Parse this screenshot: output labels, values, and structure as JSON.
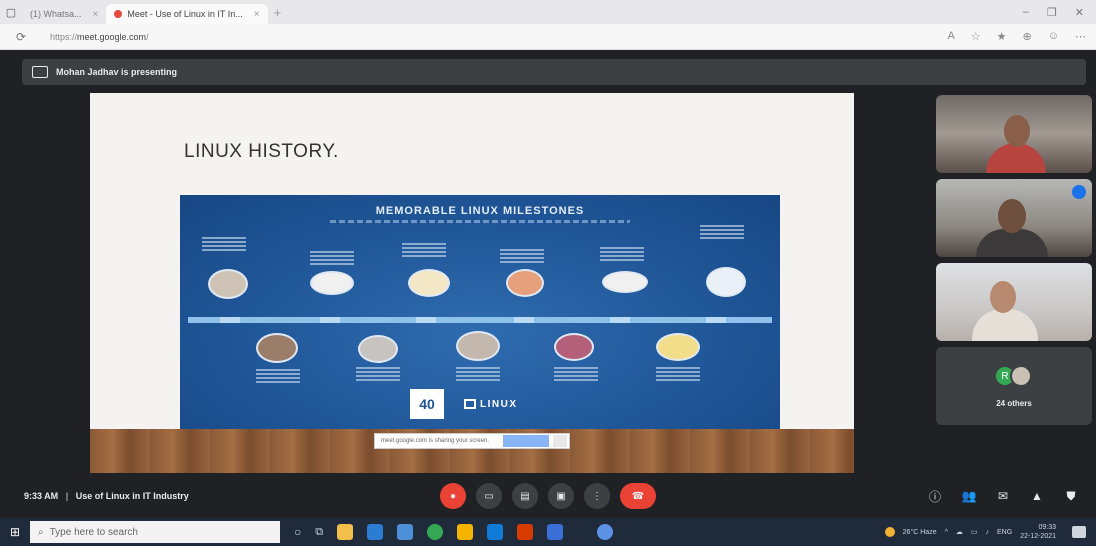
{
  "browser": {
    "tabs": [
      {
        "label": "(1) Whatsa..."
      },
      {
        "label": "Meet - Use of Linux in IT In..."
      }
    ],
    "url_prefix": "https://",
    "url_domain": "meet.google.com",
    "url_path": "/"
  },
  "meet": {
    "presenter_text": "Mohan Jadhav is presenting",
    "slide": {
      "title": "LINUX HISTORY.",
      "poster_title": "MEMORABLE LINUX MILESTONES",
      "logo_40": "40",
      "logo_linux": "LINUX",
      "stop_sharing_text": "meet.google.com is sharing your screen."
    },
    "others_avatar_letter": "R",
    "others_label": "24 others",
    "meeting_time": "9:33 AM",
    "meeting_name": "Use of Linux in IT Industry"
  },
  "taskbar": {
    "search_placeholder": "Type here to search",
    "weather": "26°C Haze",
    "lang": "ENG",
    "time": "09:33",
    "date": "22-12-2021"
  },
  "colors": {
    "meet_bg": "#202124",
    "end_call": "#ea4335",
    "poster_blue": "#1f5596"
  }
}
